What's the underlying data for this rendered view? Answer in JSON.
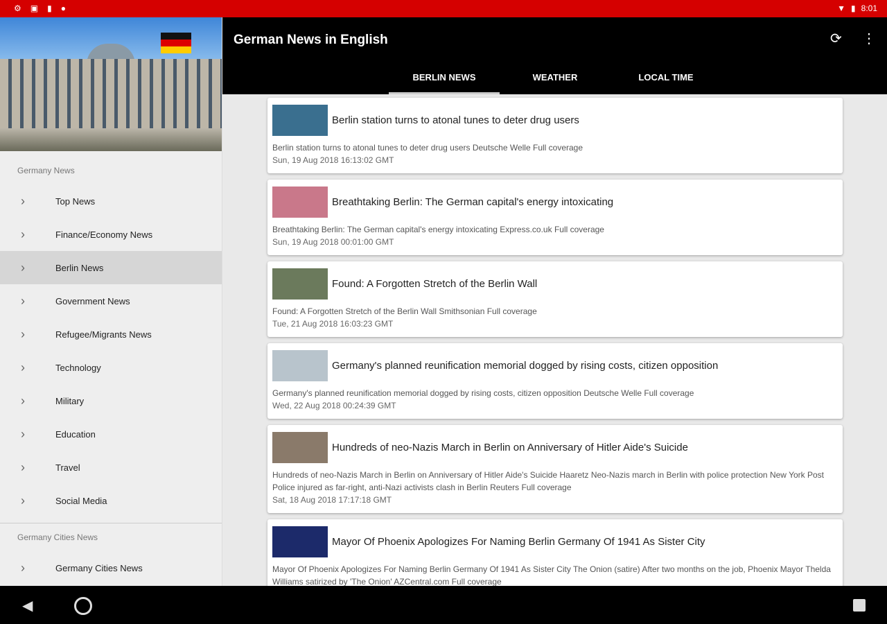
{
  "status": {
    "time": "8:01",
    "icons": [
      "gear-icon",
      "sim-icon",
      "clipboard-icon",
      "record-icon",
      "wifi-icon",
      "battery-icon"
    ]
  },
  "appbar": {
    "title": "German News in English",
    "refresh_icon": "refresh-icon",
    "menu_icon": "more-vert-icon"
  },
  "tabs": [
    {
      "label": "BERLIN NEWS",
      "active": true
    },
    {
      "label": "WEATHER"
    },
    {
      "label": "LOCAL TIME"
    }
  ],
  "sidebar": {
    "section1": "Germany News",
    "items": [
      "Top News",
      "Finance/Economy News",
      "Berlin News",
      "Government News",
      "Refugee/Migrants News",
      "Technology",
      "Military",
      "Education",
      "Travel",
      "Social Media"
    ],
    "active": "Berlin News",
    "section2": "Germany Cities News",
    "items2": [
      "Germany Cities News"
    ]
  },
  "articles": [
    {
      "title": "Berlin station turns to atonal tunes to deter drug users",
      "desc": "Berlin station turns to atonal tunes to deter drug users  Deutsche Welle  Full coverage",
      "date": "Sun, 19 Aug 2018 16:13:02 GMT",
      "thumb": "#3a6f8f"
    },
    {
      "title": "Breathtaking Berlin: The German capital's energy intoxicating",
      "desc": "Breathtaking Berlin: The German capital's energy intoxicating  Express.co.uk  Full coverage",
      "date": "Sun, 19 Aug 2018 00:01:00 GMT",
      "thumb": "#c9788a"
    },
    {
      "title": "Found: A Forgotten Stretch of the Berlin Wall",
      "desc": "Found: A Forgotten Stretch of the Berlin Wall  Smithsonian  Full coverage",
      "date": "Tue, 21 Aug 2018 16:03:23 GMT",
      "thumb": "#6b7a5c"
    },
    {
      "title": "Germany's planned reunification memorial dogged by rising costs, citizen opposition",
      "desc": "Germany's planned reunification memorial dogged by rising costs, citizen opposition  Deutsche Welle  Full coverage",
      "date": "Wed, 22 Aug 2018 00:24:39 GMT",
      "thumb": "#b8c4cc"
    },
    {
      "title": "Hundreds of neo-Nazis March in Berlin on Anniversary of Hitler Aide's Suicide",
      "desc": "Hundreds of neo-Nazis March in Berlin on Anniversary of Hitler Aide's Suicide  Haaretz  Neo-Nazis march in Berlin with police protection  New York Post  Police injured as far-right, anti-Nazi activists clash in Berlin  Reuters  Full coverage",
      "date": "Sat, 18 Aug 2018 17:17:18 GMT",
      "thumb": "#8a7a6a"
    },
    {
      "title": "Mayor Of Phoenix Apologizes For Naming Berlin Germany Of 1941 As Sister City",
      "desc": "Mayor Of Phoenix Apologizes For Naming Berlin Germany Of 1941 As Sister City  The Onion (satire)  After two months on the job, Phoenix Mayor Thelda Williams satirized by 'The Onion'  AZCentral.com  Full coverage",
      "date": "",
      "thumb": "#1c2a6a"
    }
  ]
}
